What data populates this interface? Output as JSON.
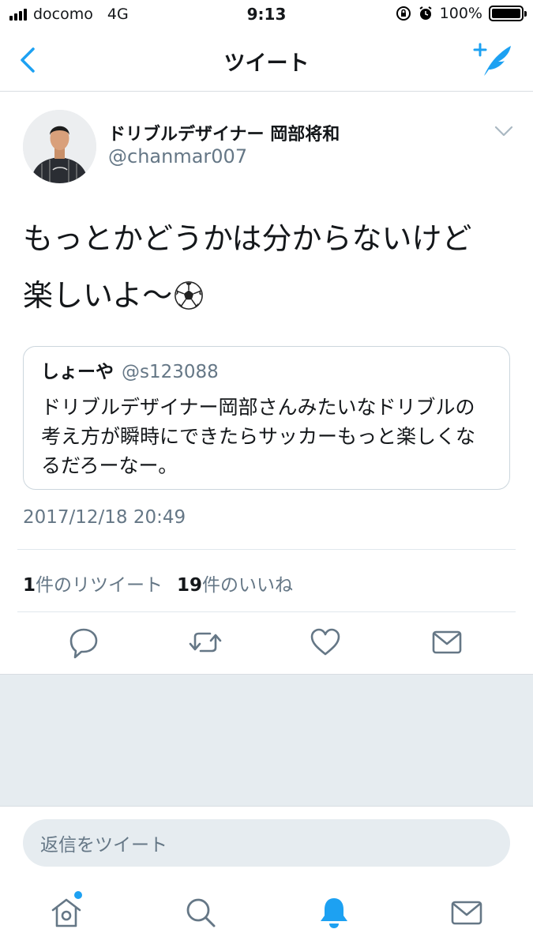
{
  "status_bar": {
    "carrier": "docomo",
    "network": "4G",
    "time": "9:13",
    "battery": "100%",
    "battery_level": 1.0
  },
  "header": {
    "title": "ツイート",
    "back_icon": "chevron-left-icon",
    "compose_icon": "compose-tweet-icon"
  },
  "tweet": {
    "author_name": "ドリブルデザイナー 岡部将和",
    "author_handle": "@chanmar007",
    "text_line1": "もっとかどうかは分からないけど",
    "text_line2": "楽しいよ〜",
    "emoji": "soccer-ball-icon",
    "quoted": {
      "name": "しょーや",
      "handle": "@s123088",
      "text": "ドリブルデザイナー岡部さんみたいなドリブルの考え方が瞬時にできたらサッカーもっと楽しくなるだろーなー。"
    },
    "timestamp": "2017/12/18 20:49",
    "retweet_count": "1",
    "retweet_label": "件のリツイート",
    "like_count": "19",
    "like_label": "件のいいね"
  },
  "actions": [
    "reply-icon",
    "retweet-icon",
    "like-icon",
    "share-icon"
  ],
  "reply": {
    "placeholder": "返信をツイート"
  },
  "tabbar": [
    "home-icon",
    "search-icon",
    "notifications-icon",
    "messages-icon"
  ],
  "colors": {
    "accent": "#1da1f2",
    "secondary_text": "#657786",
    "border": "#e1e8ed",
    "background_grey": "#e6ecf0"
  }
}
